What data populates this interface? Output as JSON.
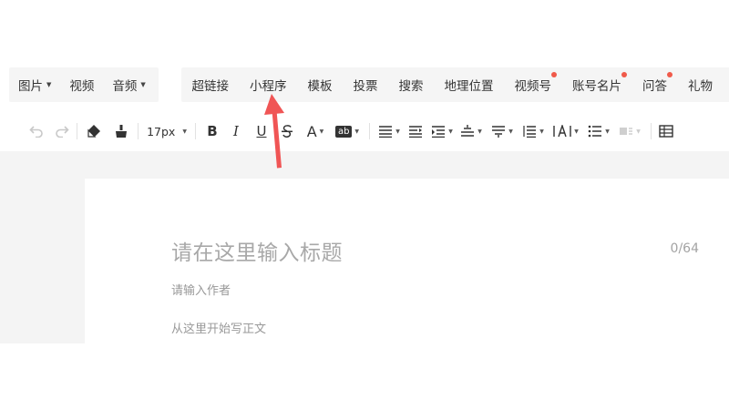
{
  "menu_left": [
    {
      "label": "图片",
      "caret": true
    },
    {
      "label": "视频",
      "caret": false
    },
    {
      "label": "音频",
      "caret": true
    }
  ],
  "menu_right": [
    {
      "label": "超链接"
    },
    {
      "label": "小程序"
    },
    {
      "label": "模板"
    },
    {
      "label": "投票"
    },
    {
      "label": "搜索"
    },
    {
      "label": "地理位置"
    },
    {
      "label": "视频号",
      "dot": true
    },
    {
      "label": "账号名片",
      "dot": true
    },
    {
      "label": "问答",
      "dot": true
    },
    {
      "label": "礼物"
    }
  ],
  "toolbar": {
    "font_size": "17px",
    "bold": "B",
    "italic": "I",
    "underline": "U",
    "font_color": "A",
    "bg_color": "ab"
  },
  "editor": {
    "title_placeholder": "请在这里输入标题",
    "title_counter": "0/64",
    "author_placeholder": "请输入作者",
    "body_placeholder": "从这里开始写正文"
  },
  "colors": {
    "notification_dot": "#f05a4a",
    "annotation_arrow": "#f05555"
  }
}
